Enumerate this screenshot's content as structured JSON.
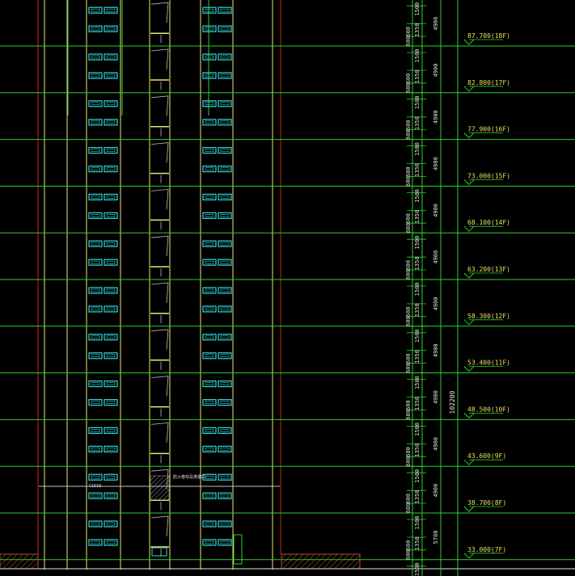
{
  "app": "CAD elevation drawing viewport",
  "colors": {
    "background": "#000000",
    "floor_line": "#2bd12b",
    "outline_red": "#d42020",
    "wall_yellow": "#e8e870",
    "window_cyan": "#33d6d6",
    "dim_text": "#e6e6e6",
    "level_text": "#e6e060",
    "level_marker": "#2bd12b",
    "hatch": "#8a8a8a"
  },
  "floor_levels": [
    {
      "label": "87.700(18F)"
    },
    {
      "label": "82.800(17F)"
    },
    {
      "label": "77.900(16F)"
    },
    {
      "label": "73.000(15F)"
    },
    {
      "label": "68.100(14F)"
    },
    {
      "label": "63.200(13F)"
    },
    {
      "label": "58.300(12F)"
    },
    {
      "label": "53.400(11F)"
    },
    {
      "label": "48.500(10F)"
    },
    {
      "label": "43.600(9F)"
    },
    {
      "label": "38.700(8F)"
    },
    {
      "label": "33.000(7F)"
    }
  ],
  "dimensions": {
    "sub_labels": [
      "600",
      "1350",
      "1500"
    ],
    "story_labels": [
      "4900",
      "4900",
      "4900",
      "4900",
      "4900",
      "4900",
      "4900",
      "4900",
      "4900",
      "4900",
      "4900",
      "5700"
    ],
    "total_label": "102200"
  },
  "annotations": {
    "stair_note": "防火卷帘及排烟口",
    "window_tag": "C1518"
  }
}
